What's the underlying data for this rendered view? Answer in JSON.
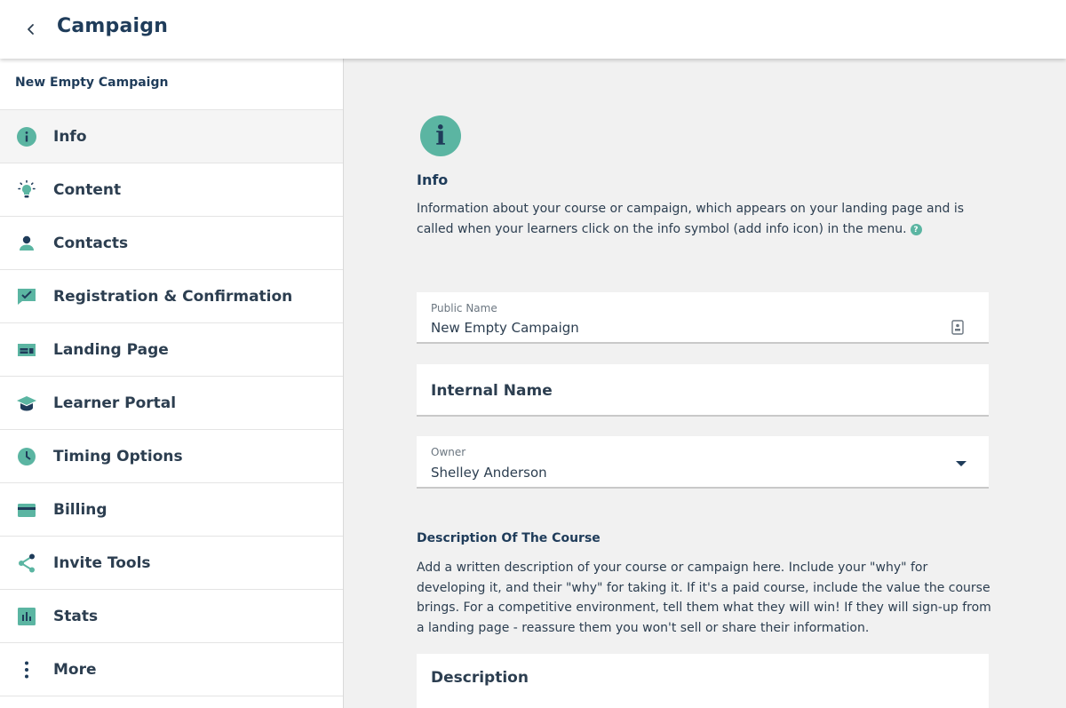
{
  "header": {
    "title": "Campaign"
  },
  "sidebar": {
    "campaign_name": "New Empty Campaign",
    "items": [
      {
        "label": "Info",
        "icon": "info-icon"
      },
      {
        "label": "Content",
        "icon": "lightbulb-icon"
      },
      {
        "label": "Contacts",
        "icon": "person-icon"
      },
      {
        "label": "Registration & Confirmation",
        "icon": "chat-check-icon"
      },
      {
        "label": "Landing Page",
        "icon": "web-page-icon"
      },
      {
        "label": "Learner Portal",
        "icon": "graduation-cap-icon"
      },
      {
        "label": "Timing Options",
        "icon": "clock-icon"
      },
      {
        "label": "Billing",
        "icon": "credit-card-icon"
      },
      {
        "label": "Invite Tools",
        "icon": "share-icon"
      },
      {
        "label": "Stats",
        "icon": "bar-chart-icon"
      },
      {
        "label": "More",
        "icon": "more-vertical-icon"
      }
    ]
  },
  "main": {
    "icon_glyph": "i",
    "title": "Info",
    "description": "Information about your course or campaign, which appears on your landing page and is called when your learners click on the info symbol (add info icon) in the menu.",
    "help_glyph": "?",
    "public_name": {
      "label": "Public Name",
      "value": "New Empty Campaign"
    },
    "internal_name": {
      "placeholder": "Internal Name"
    },
    "owner": {
      "label": "Owner",
      "value": "Shelley Anderson"
    },
    "description_section": {
      "title": "Description Of The Course",
      "text": "Add a written description of your course or campaign here. Include your \"why\" for developing it, and their \"why\" for taking it. If it's a paid course, include the value the course brings. For a competitive environment, tell them what they will win! If they will sign-up from a landing page - reassure them you won't sell or share their information.",
      "placeholder": "Description"
    }
  },
  "colors": {
    "accent": "#5bb5a2",
    "navy": "#1f3c5a",
    "text": "#2c3e50",
    "background": "#f1f1f1"
  }
}
